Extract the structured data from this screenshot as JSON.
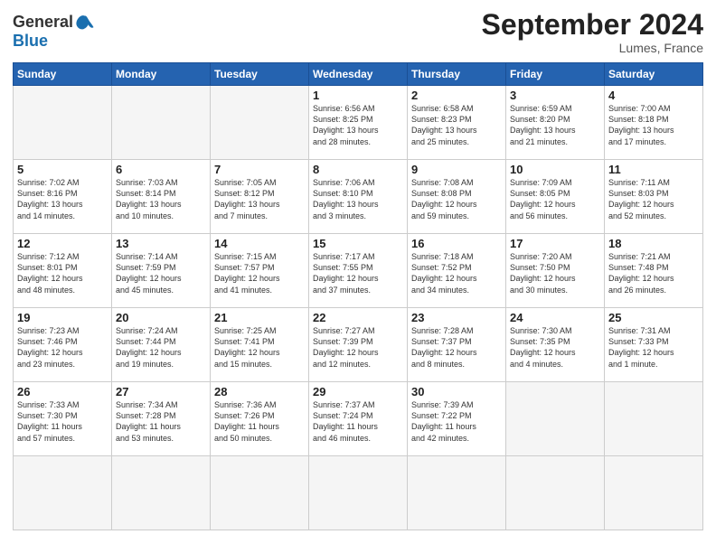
{
  "header": {
    "logo_line1": "General",
    "logo_line2": "Blue",
    "month_title": "September 2024",
    "location": "Lumes, France"
  },
  "weekdays": [
    "Sunday",
    "Monday",
    "Tuesday",
    "Wednesday",
    "Thursday",
    "Friday",
    "Saturday"
  ],
  "days": [
    {
      "num": "",
      "info": ""
    },
    {
      "num": "",
      "info": ""
    },
    {
      "num": "",
      "info": ""
    },
    {
      "num": "1",
      "info": "Sunrise: 6:56 AM\nSunset: 8:25 PM\nDaylight: 13 hours\nand 28 minutes."
    },
    {
      "num": "2",
      "info": "Sunrise: 6:58 AM\nSunset: 8:23 PM\nDaylight: 13 hours\nand 25 minutes."
    },
    {
      "num": "3",
      "info": "Sunrise: 6:59 AM\nSunset: 8:20 PM\nDaylight: 13 hours\nand 21 minutes."
    },
    {
      "num": "4",
      "info": "Sunrise: 7:00 AM\nSunset: 8:18 PM\nDaylight: 13 hours\nand 17 minutes."
    },
    {
      "num": "5",
      "info": "Sunrise: 7:02 AM\nSunset: 8:16 PM\nDaylight: 13 hours\nand 14 minutes."
    },
    {
      "num": "6",
      "info": "Sunrise: 7:03 AM\nSunset: 8:14 PM\nDaylight: 13 hours\nand 10 minutes."
    },
    {
      "num": "7",
      "info": "Sunrise: 7:05 AM\nSunset: 8:12 PM\nDaylight: 13 hours\nand 7 minutes."
    },
    {
      "num": "8",
      "info": "Sunrise: 7:06 AM\nSunset: 8:10 PM\nDaylight: 13 hours\nand 3 minutes."
    },
    {
      "num": "9",
      "info": "Sunrise: 7:08 AM\nSunset: 8:08 PM\nDaylight: 12 hours\nand 59 minutes."
    },
    {
      "num": "10",
      "info": "Sunrise: 7:09 AM\nSunset: 8:05 PM\nDaylight: 12 hours\nand 56 minutes."
    },
    {
      "num": "11",
      "info": "Sunrise: 7:11 AM\nSunset: 8:03 PM\nDaylight: 12 hours\nand 52 minutes."
    },
    {
      "num": "12",
      "info": "Sunrise: 7:12 AM\nSunset: 8:01 PM\nDaylight: 12 hours\nand 48 minutes."
    },
    {
      "num": "13",
      "info": "Sunrise: 7:14 AM\nSunset: 7:59 PM\nDaylight: 12 hours\nand 45 minutes."
    },
    {
      "num": "14",
      "info": "Sunrise: 7:15 AM\nSunset: 7:57 PM\nDaylight: 12 hours\nand 41 minutes."
    },
    {
      "num": "15",
      "info": "Sunrise: 7:17 AM\nSunset: 7:55 PM\nDaylight: 12 hours\nand 37 minutes."
    },
    {
      "num": "16",
      "info": "Sunrise: 7:18 AM\nSunset: 7:52 PM\nDaylight: 12 hours\nand 34 minutes."
    },
    {
      "num": "17",
      "info": "Sunrise: 7:20 AM\nSunset: 7:50 PM\nDaylight: 12 hours\nand 30 minutes."
    },
    {
      "num": "18",
      "info": "Sunrise: 7:21 AM\nSunset: 7:48 PM\nDaylight: 12 hours\nand 26 minutes."
    },
    {
      "num": "19",
      "info": "Sunrise: 7:23 AM\nSunset: 7:46 PM\nDaylight: 12 hours\nand 23 minutes."
    },
    {
      "num": "20",
      "info": "Sunrise: 7:24 AM\nSunset: 7:44 PM\nDaylight: 12 hours\nand 19 minutes."
    },
    {
      "num": "21",
      "info": "Sunrise: 7:25 AM\nSunset: 7:41 PM\nDaylight: 12 hours\nand 15 minutes."
    },
    {
      "num": "22",
      "info": "Sunrise: 7:27 AM\nSunset: 7:39 PM\nDaylight: 12 hours\nand 12 minutes."
    },
    {
      "num": "23",
      "info": "Sunrise: 7:28 AM\nSunset: 7:37 PM\nDaylight: 12 hours\nand 8 minutes."
    },
    {
      "num": "24",
      "info": "Sunrise: 7:30 AM\nSunset: 7:35 PM\nDaylight: 12 hours\nand 4 minutes."
    },
    {
      "num": "25",
      "info": "Sunrise: 7:31 AM\nSunset: 7:33 PM\nDaylight: 12 hours\nand 1 minute."
    },
    {
      "num": "26",
      "info": "Sunrise: 7:33 AM\nSunset: 7:30 PM\nDaylight: 11 hours\nand 57 minutes."
    },
    {
      "num": "27",
      "info": "Sunrise: 7:34 AM\nSunset: 7:28 PM\nDaylight: 11 hours\nand 53 minutes."
    },
    {
      "num": "28",
      "info": "Sunrise: 7:36 AM\nSunset: 7:26 PM\nDaylight: 11 hours\nand 50 minutes."
    },
    {
      "num": "29",
      "info": "Sunrise: 7:37 AM\nSunset: 7:24 PM\nDaylight: 11 hours\nand 46 minutes."
    },
    {
      "num": "30",
      "info": "Sunrise: 7:39 AM\nSunset: 7:22 PM\nDaylight: 11 hours\nand 42 minutes."
    },
    {
      "num": "",
      "info": ""
    },
    {
      "num": "",
      "info": ""
    },
    {
      "num": "",
      "info": ""
    },
    {
      "num": "",
      "info": ""
    },
    {
      "num": "",
      "info": ""
    }
  ]
}
